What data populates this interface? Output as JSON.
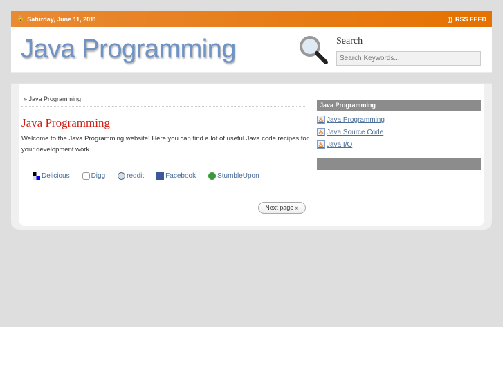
{
  "topbar": {
    "date": "Saturday, June 11, 2011",
    "rss": "RSS FEED"
  },
  "header": {
    "logo": "Java Programming",
    "search_title": "Search",
    "search_placeholder": "Search Keywords..."
  },
  "main": {
    "breadcrumb": "» Java Programming",
    "title": "Java Programming",
    "intro": "Welcome to the Java Programming website! Here you can find a lot of useful Java code recipes for your development work.",
    "share": [
      "Delicious",
      "Digg",
      "reddit",
      "Facebook",
      "StumbleUpon"
    ],
    "next": "Next page »"
  },
  "sidebar": {
    "heading": "Java Programming",
    "links": [
      "Java Programming",
      "Java Source Code",
      "Java I/O"
    ]
  },
  "colors": {
    "accent": "#e57200",
    "title": "#d51e12",
    "link": "#4a6e99"
  }
}
